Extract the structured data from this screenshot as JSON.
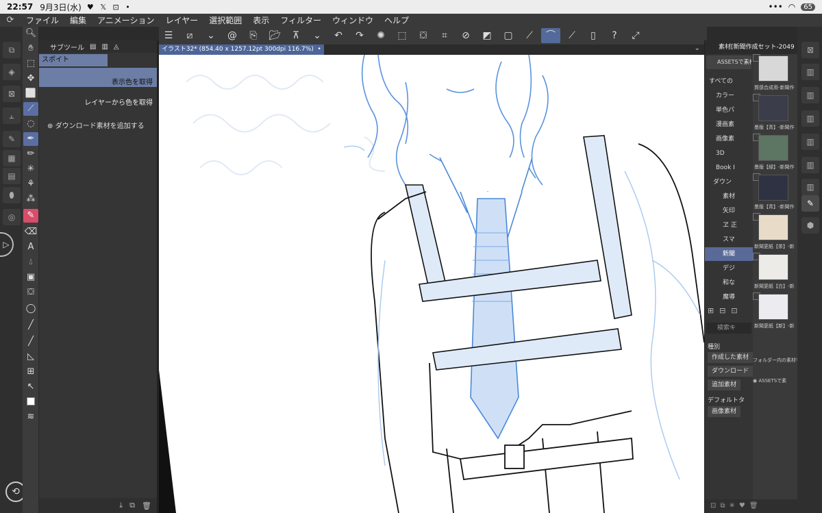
{
  "status": {
    "time": "22:57",
    "date": "9月3日(水)",
    "icons": "♥ 𝕏 ⊡ •",
    "wifi": "wifi-icon",
    "battery": "65"
  },
  "menu": {
    "items": [
      "ファイル",
      "編集",
      "アニメーション",
      "レイヤー",
      "選択範囲",
      "表示",
      "フィルター",
      "ウィンドウ",
      "ヘルプ"
    ]
  },
  "subtool": {
    "title": "サブツール",
    "tab": "スポイト",
    "items": [
      "表示色を取得",
      "レイヤーから色を取得"
    ],
    "add": "ダウンロード素材を追加する"
  },
  "canvas": {
    "tab": "イラスト32* (854.40 x 1257.12pt 300dpi 116.7%)"
  },
  "material": {
    "title": "素材[新聞作成セット-2049",
    "assets": "ASSETSで素材",
    "tree": [
      "すべての",
      "カラー",
      "単色パ",
      "漫画素",
      "画像素",
      "3D",
      "Book I",
      "ダウン",
      "素材",
      "矢印",
      "ヱ 正",
      "スマ",
      "新聞",
      "デジ",
      "和な",
      "魔導"
    ],
    "search": "検索キ",
    "kind_label": "種別",
    "kinds": [
      "作成した素材",
      "ダウンロード",
      "追加素材"
    ],
    "default_label": "デフォルトタ",
    "default_btn": "画像素材",
    "thumbs": [
      {
        "caption": "質感合成用-新聞作",
        "color": "#d8d8d8"
      },
      {
        "caption": "墨版【青】-新聞作",
        "color": "#3c3d4a"
      },
      {
        "caption": "墨版【緑】-新聞作",
        "color": "#5d7563"
      },
      {
        "caption": "墨版【青】-新聞作",
        "color": "#2f3242"
      },
      {
        "caption": "新聞更紙【茶】-新",
        "color": "#e8dcc8"
      },
      {
        "caption": "新聞更紙【白】-新",
        "color": "#ecebe8"
      },
      {
        "caption": "新聞更紙【新】-新",
        "color": "#ececf0"
      }
    ],
    "folder_contents": "フォルダー内の素材を",
    "assets2": "ASSETSで素"
  },
  "colors": {
    "accent": "#5a6ea3",
    "pen_blue": "#4a88d8",
    "light_blue": "#cfe0f6"
  }
}
